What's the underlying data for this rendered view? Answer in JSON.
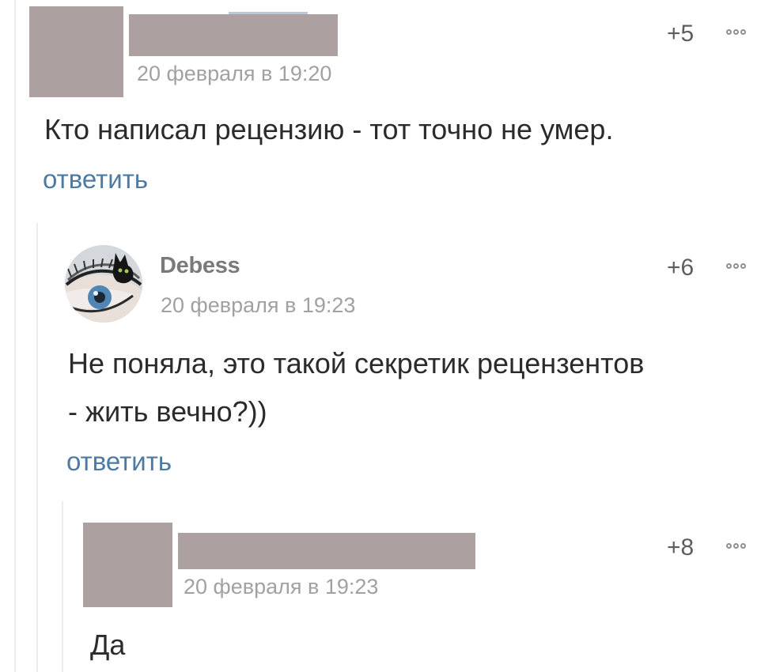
{
  "comments": [
    {
      "author": "",
      "date": "20 февраля в 19:20",
      "rating": "+5",
      "text_lines": [
        "Кто написал рецензию - тот точно не умер."
      ],
      "reply": "ответить"
    },
    {
      "author": "Debess",
      "date": "20 февраля в 19:23",
      "rating": "+6",
      "text_lines": [
        "Не поняла, это такой секретик рецензентов",
        "- жить вечно?))"
      ],
      "reply": "ответить"
    },
    {
      "author": "",
      "date": "20 февраля в 19:23",
      "rating": "+8",
      "text_lines": [
        "Да"
      ]
    }
  ],
  "icons": {
    "more": "more-options-icon",
    "avatar": "avatar-eye-cat"
  },
  "colors": {
    "reply_link": "#4d7aa3",
    "redaction": "#aca0a0",
    "thread_line": "#ececec"
  }
}
